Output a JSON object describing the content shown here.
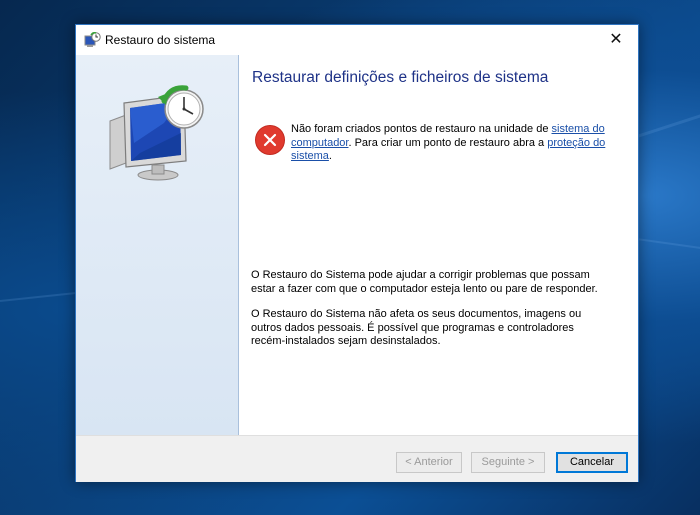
{
  "window": {
    "title": "Restauro do sistema",
    "close_glyph": "✕"
  },
  "content": {
    "heading": "Restaurar definições e ficheiros de sistema",
    "error": {
      "icon": "error-icon",
      "text_before": "Não foram criados pontos de restauro na unidade de ",
      "link1": "sistema do computador",
      "text_middle": ". Para criar um ponto de restauro abra a ",
      "link2": "proteção do sistema",
      "text_after": "."
    },
    "paragraph1": "O Restauro do Sistema pode ajudar a corrigir problemas que possam estar a fazer com que o computador esteja lento ou pare de responder.",
    "paragraph2": "O Restauro do Sistema não afeta os seus documentos, imagens ou outros dados pessoais. É possível que programas e controladores recém-instalados sejam desinstalados."
  },
  "buttons": {
    "back": "< Anterior",
    "next": "Seguinte >",
    "cancel": "Cancelar"
  },
  "colors": {
    "heading": "#1e3287",
    "link": "#1a4fa8",
    "error": "#e03a2e",
    "accent": "#0078d7"
  }
}
